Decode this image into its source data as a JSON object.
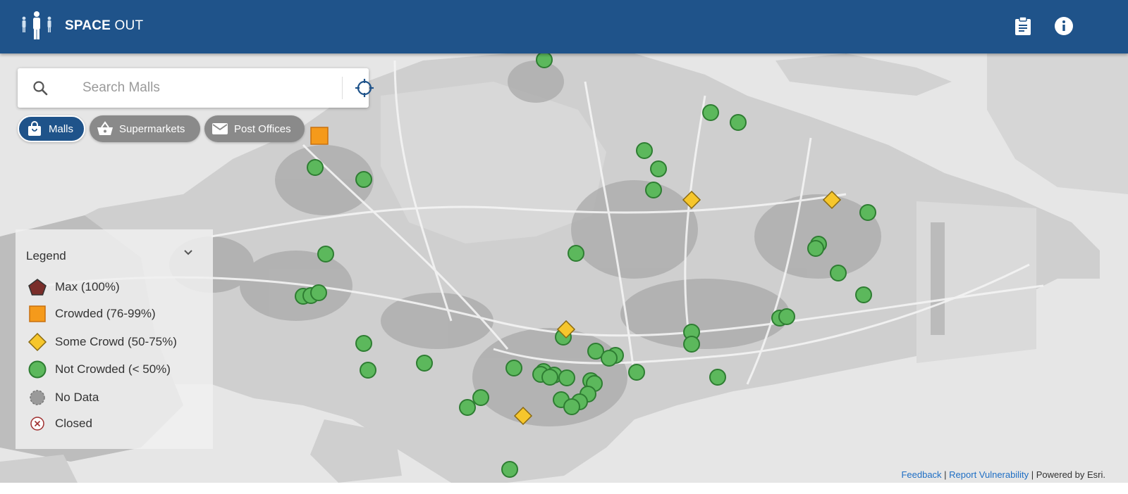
{
  "header": {
    "title_bold": "SPACE",
    "title_light": " OUT",
    "clipboard_icon": "clipboard-icon",
    "info_icon": "info-icon"
  },
  "search": {
    "placeholder": "Search Malls",
    "icon": "search-icon",
    "locate_icon": "crosshair-icon"
  },
  "filters": [
    {
      "label": "Malls",
      "icon": "shopping-bag-icon",
      "active": true
    },
    {
      "label": "Supermarkets",
      "icon": "basket-icon",
      "active": false
    },
    {
      "label": "Post Offices",
      "icon": "envelope-icon",
      "active": false
    }
  ],
  "legend": {
    "title": "Legend",
    "items": [
      {
        "label": "Max (100%)",
        "symbol": "pentagon",
        "color": "#7a2e2a"
      },
      {
        "label": "Crowded (76-99%)",
        "symbol": "square",
        "color": "#f59a1b"
      },
      {
        "label": "Some Crowd (50-75%)",
        "symbol": "diamond",
        "color": "#f6c62c"
      },
      {
        "label": "Not Crowded (< 50%)",
        "symbol": "circle",
        "color": "#5cb85c"
      },
      {
        "label": "No Data",
        "symbol": "circle",
        "color": "#9a9a9a"
      },
      {
        "label": "Closed",
        "symbol": "x-circle",
        "color": "#a03030"
      }
    ]
  },
  "attribution": {
    "feedback": "Feedback",
    "sep1": " | ",
    "report": "Report Vulnerability",
    "powered": " | Powered by Esri."
  },
  "colors": {
    "header": "#1f538a",
    "not_crowded": "#5cb85c",
    "some_crowd": "#f6c62c",
    "crowded": "#f59a1b"
  }
}
